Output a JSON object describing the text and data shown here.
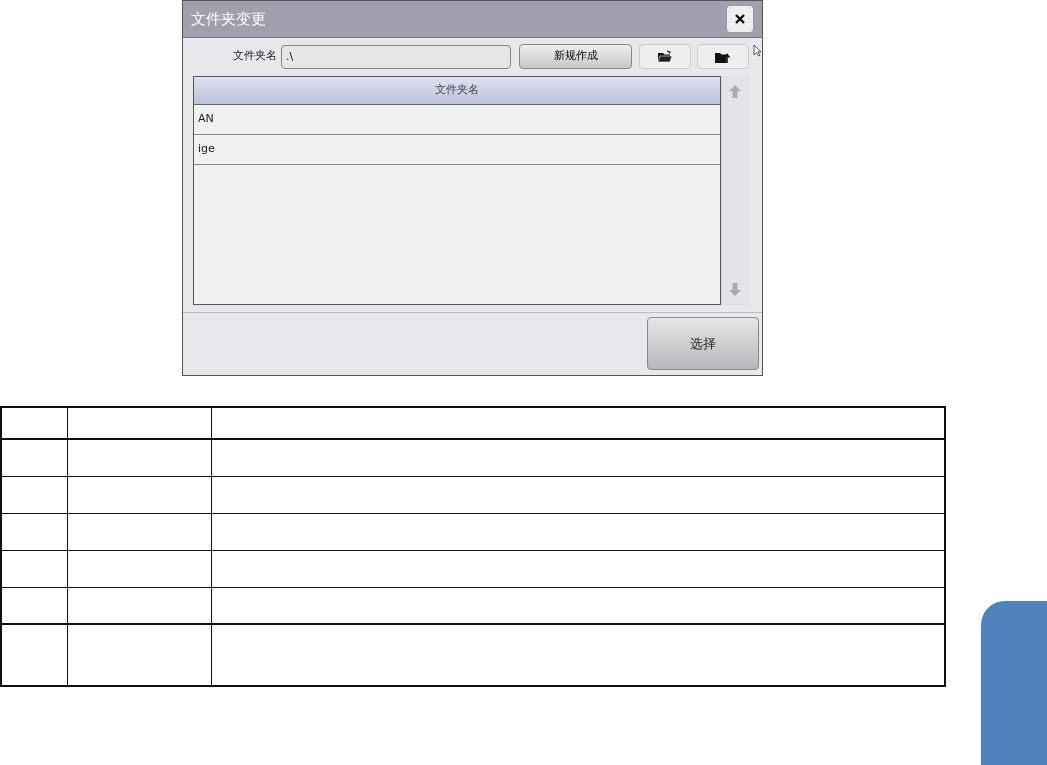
{
  "dialog": {
    "title": "文件夹变更",
    "folder_label": "文件夹名",
    "folder_value": ".\\",
    "new_button": "新规作成",
    "list_header": "文件夹名",
    "rows": [
      {
        "name": "AN"
      },
      {
        "name": "ige"
      }
    ],
    "select_button": "选择"
  }
}
